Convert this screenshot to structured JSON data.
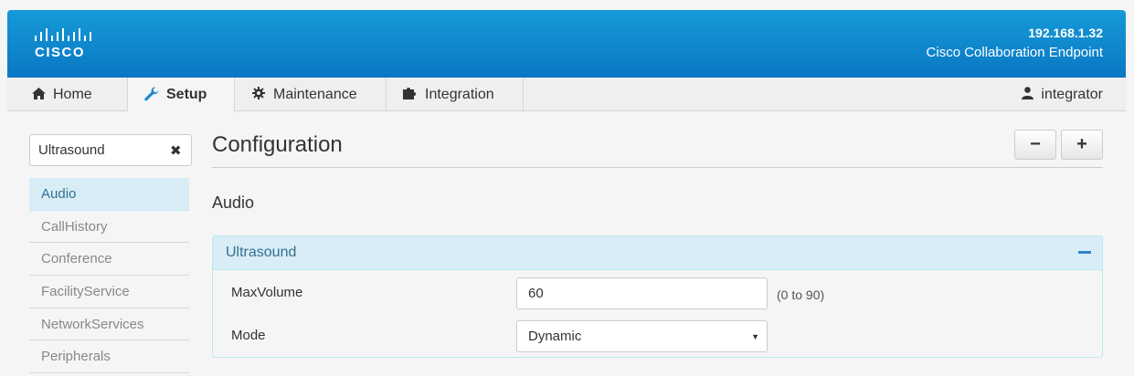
{
  "header": {
    "brand": "CISCO",
    "host": "192.168.1.32",
    "product": "Cisco Collaboration Endpoint"
  },
  "nav": {
    "tabs": [
      {
        "label": "Home",
        "icon": "home-icon"
      },
      {
        "label": "Setup",
        "icon": "wrench-icon",
        "active": true
      },
      {
        "label": "Maintenance",
        "icon": "gear-icon"
      },
      {
        "label": "Integration",
        "icon": "puzzle-icon"
      }
    ],
    "user": "integrator"
  },
  "sidebar": {
    "search_value": "Ultrasound",
    "items": [
      {
        "label": "Audio",
        "active": true
      },
      {
        "label": "CallHistory"
      },
      {
        "label": "Conference"
      },
      {
        "label": "FacilityService"
      },
      {
        "label": "NetworkServices"
      },
      {
        "label": "Peripherals"
      }
    ]
  },
  "main": {
    "title": "Configuration",
    "collapse_all": "−",
    "expand_all": "+",
    "section": "Audio",
    "panel": {
      "title": "Ultrasound",
      "rows": [
        {
          "label": "MaxVolume",
          "value": "60",
          "range": "(0 to 90)"
        },
        {
          "label": "Mode",
          "value": "Dynamic"
        }
      ]
    }
  },
  "colors": {
    "header_top": "#169ad7",
    "header_bottom": "#0a77c4",
    "accent": "#1f86d4",
    "panel_bg": "#d9edf7",
    "panel_text": "#31708f"
  }
}
